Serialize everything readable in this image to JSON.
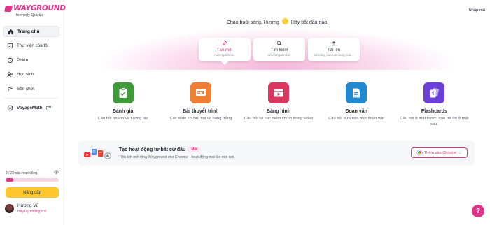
{
  "brand": {
    "name": "WAYGROUND",
    "sub": "formerly Quizizz",
    "color": "#e0338a"
  },
  "header": {
    "login": "Nhập mã"
  },
  "sidebar": {
    "items": [
      {
        "label": "Trang chủ",
        "icon": "home-icon",
        "active": true
      },
      {
        "label": "Thư viện của tôi",
        "icon": "library-icon"
      },
      {
        "label": "Phiên",
        "icon": "sessions-icon"
      },
      {
        "label": "Học sinh",
        "icon": "students-icon"
      },
      {
        "label": "Sân chơi",
        "icon": "playground-icon"
      }
    ],
    "voyage": {
      "label": "VoyageMath",
      "icon": "external-link-icon"
    },
    "activities": {
      "label": "3 / 20 các hoạt động",
      "used": 3,
      "total": 20
    },
    "upgrade": "Nâng cấp",
    "user": {
      "name": "Hương Vũ",
      "cta": "Hãy lấy chứng chỉ!"
    }
  },
  "hero": {
    "greeting_before": "Chào buổi sáng, Hương",
    "greeting_after": "Hãy bắt đầu nào.",
    "tabs": [
      {
        "label": "Tạo mới",
        "sub": "mới nguồn lực",
        "icon": "pencil-icon",
        "active": true
      },
      {
        "label": "Tìm kiếm",
        "sub": "để có nguồn lực",
        "icon": "search-icon"
      },
      {
        "label": "Tải lên",
        "sub": "và nâng cao nội dung của...",
        "icon": "upload-icon"
      }
    ]
  },
  "cards": [
    {
      "title": "Đánh giá",
      "desc": "Câu hỏi nhanh và tương tác",
      "color": "#3f9b3a"
    },
    {
      "title": "Bài thuyết trình",
      "desc": "Các slide có câu hỏi và bảng trắng",
      "color": "#f07e33"
    },
    {
      "title": "Băng hình",
      "desc": "Câu hỏi tại các điểm chính trong video",
      "color": "#d9375f"
    },
    {
      "title": "Đoạn văn",
      "desc": "Câu hỏi dựa trên một đoạn văn",
      "color": "#1f8ad1"
    },
    {
      "title": "Flashcards",
      "desc": "Câu hỏi ở mặt trước, câu trả lời ở mặt sau.",
      "color": "#6b3fd8"
    }
  ],
  "banner": {
    "title": "Tạo hoạt động từ bất cứ đâu",
    "badge": "Mới",
    "sub": "Tiện ích mở rộng Wayground cho Chrome - hoạt động mọi lúc mọi nơi.",
    "button": "Thêm vào Chrome →"
  },
  "help": "?"
}
